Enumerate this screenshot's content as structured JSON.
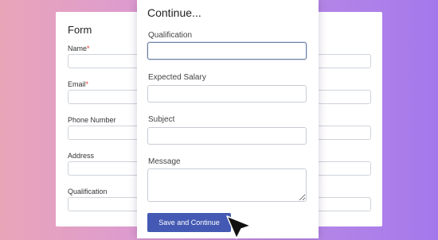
{
  "background_form": {
    "title": "Form",
    "fields": [
      {
        "label": "Name",
        "required_mark": "*"
      },
      {
        "label": "Email",
        "required_mark": "*"
      },
      {
        "label": "Phone Number"
      },
      {
        "label": "Address"
      },
      {
        "label": "Qualification"
      }
    ]
  },
  "modal": {
    "title": "Continue...",
    "fields": [
      {
        "label": "Qualification",
        "value": "",
        "focused": true
      },
      {
        "label": "Expected Salary",
        "value": ""
      },
      {
        "label": "Subject",
        "value": ""
      },
      {
        "label": "Message",
        "value": ""
      }
    ],
    "submit_label": "Save and Continue"
  },
  "colors": {
    "primary_button": "#4359b3",
    "required": "#dd3333"
  },
  "icons": {
    "cursor": "mouse-pointer-icon"
  }
}
